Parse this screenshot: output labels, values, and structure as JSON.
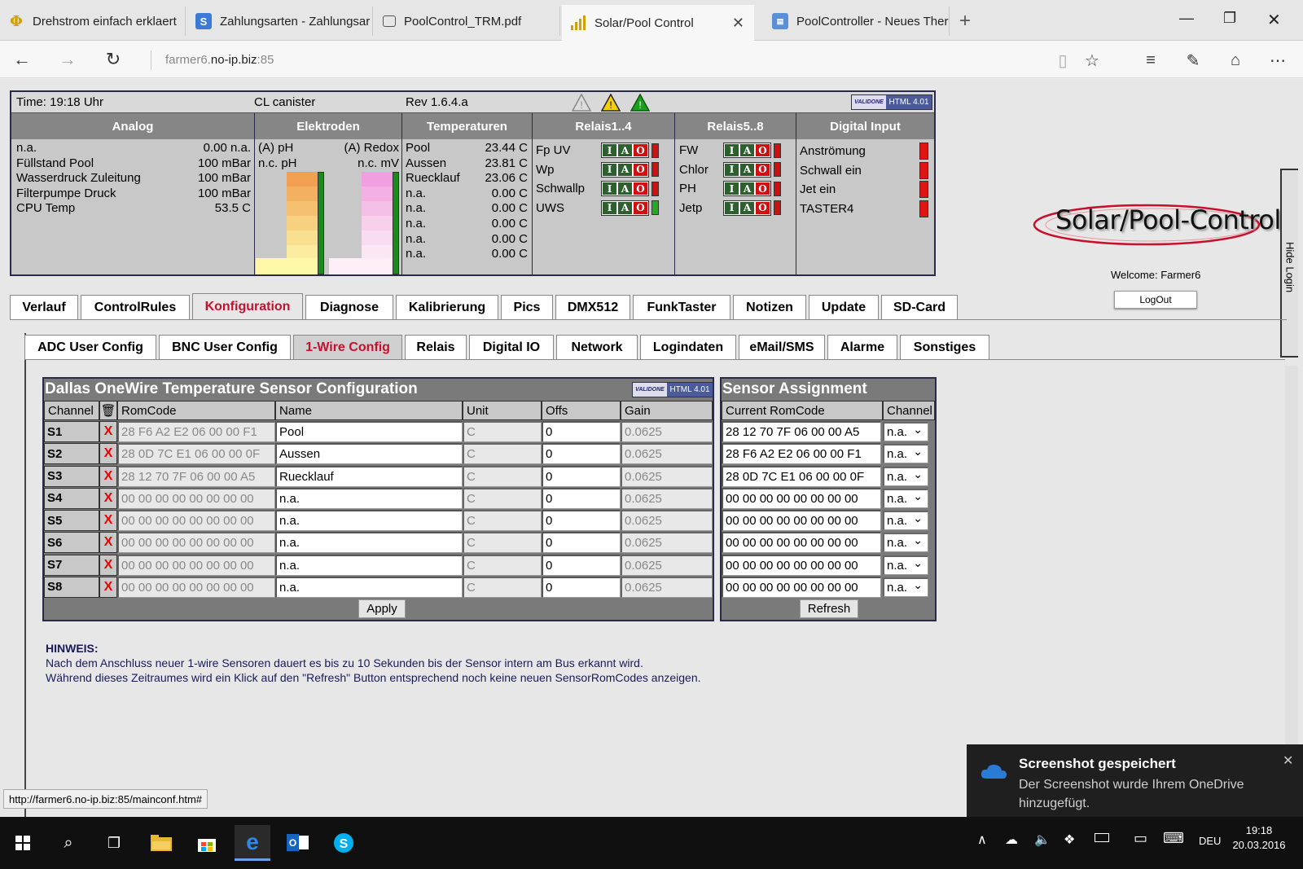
{
  "browser": {
    "tabs": [
      {
        "title": "Drehstrom einfach erklaert",
        "icon": "phi-icon",
        "active": false
      },
      {
        "title": "Zahlungsarten - Zahlungsar",
        "icon": "s-brand-icon",
        "active": false
      },
      {
        "title": "PoolControl_TRM.pdf",
        "icon": "pdf-doc-icon",
        "active": false
      },
      {
        "title": "Solar/Pool Control",
        "icon": "signal-bars-icon",
        "active": true
      },
      {
        "title": "PoolController - Neues Ther",
        "icon": "forum-icon",
        "active": false
      }
    ],
    "url_host_prefix": "farmer6.",
    "url_host": "no-ip.biz",
    "url_port": ":85"
  },
  "status": {
    "time": "Time: 19:18 Uhr",
    "cl": "CL canister",
    "rev": "Rev 1.6.4.a",
    "badge": "HTML 4.01",
    "badge_brand": "VALIDONE"
  },
  "panel": {
    "headers": {
      "analog": "Analog",
      "elektroden": "Elektroden",
      "temperaturen": "Temperaturen",
      "relais14": "Relais1..4",
      "relais58": "Relais5..8",
      "digital": "Digital Input"
    },
    "analog": [
      {
        "label": "n.a.",
        "value": "0.00 n.a."
      },
      {
        "label": "Füllstand Pool",
        "value": "100 mBar"
      },
      {
        "label": "Wasserdruck Zuleitung",
        "value": "100 mBar"
      },
      {
        "label": "Filterpumpe Druck",
        "value": "100 mBar"
      },
      {
        "label": "CPU Temp",
        "value": "53.5 C"
      }
    ],
    "elektroden": {
      "ph_label": "(A) pH",
      "ph_unit": "n.c. pH",
      "redox_label": "(A) Redox",
      "redox_unit": "n.c. mV"
    },
    "temps": [
      {
        "label": "Pool",
        "value": "23.44 C"
      },
      {
        "label": "Aussen",
        "value": "23.81 C"
      },
      {
        "label": "Ruecklauf",
        "value": "23.06 C"
      },
      {
        "label": "n.a.",
        "value": "0.00 C"
      },
      {
        "label": "n.a.",
        "value": "0.00 C"
      },
      {
        "label": "n.a.",
        "value": "0.00 C"
      },
      {
        "label": "n.a.",
        "value": "0.00 C"
      },
      {
        "label": "n.a.",
        "value": "0.00 C"
      }
    ],
    "relais14": [
      {
        "label": "Fp UV",
        "led": "#cc1111"
      },
      {
        "label": "Wp",
        "led": "#cc1111"
      },
      {
        "label": "Schwallp",
        "led": "#cc1111"
      },
      {
        "label": "UWS",
        "led": "#22aa22"
      }
    ],
    "relais58": [
      {
        "label": "FW",
        "led": "#cc1111"
      },
      {
        "label": "Chlor",
        "led": "#cc1111"
      },
      {
        "label": "PH",
        "led": "#cc1111"
      },
      {
        "label": "Jetp",
        "led": "#cc1111"
      }
    ],
    "relay_letters": [
      "I",
      "A",
      "O"
    ],
    "digital": [
      "Anströmung",
      "Schwall ein",
      "Jet ein",
      "TASTER4"
    ]
  },
  "side": {
    "logo": "Solar/Pool-Control",
    "welcome_label": "Welcome:",
    "user": "Farmer6",
    "logout": "LogOut",
    "hide_login": "Hide Login"
  },
  "main_tabs": [
    "Verlauf",
    "ControlRules",
    "Konfiguration",
    "Diagnose",
    "Kalibrierung",
    "Pics",
    "DMX512",
    "FunkTaster",
    "Notizen",
    "Update",
    "SD-Card"
  ],
  "main_tab_selected": "Konfiguration",
  "sub_tabs": [
    "ADC User Config",
    "BNC User Config",
    "1-Wire Config",
    "Relais",
    "Digital IO",
    "Network",
    "Logindaten",
    "eMail/SMS",
    "Alarme",
    "Sonstiges"
  ],
  "sub_tab_selected": "1-Wire Config",
  "onewire": {
    "title": "Dallas OneWire Temperature Sensor Configuration",
    "columns": {
      "channel": "Channel",
      "romcode": "RomCode",
      "name": "Name",
      "unit": "Unit",
      "offs": "Offs",
      "gain": "Gain"
    },
    "rows": [
      {
        "ch": "S1",
        "rom": "28 F6 A2 E2 06 00 00 F1",
        "name": "Pool",
        "unit": "C",
        "offs": "0",
        "gain": "0.0625"
      },
      {
        "ch": "S2",
        "rom": "28 0D 7C E1 06 00 00 0F",
        "name": "Aussen",
        "unit": "C",
        "offs": "0",
        "gain": "0.0625"
      },
      {
        "ch": "S3",
        "rom": "28 12 70 7F 06 00 00 A5",
        "name": "Ruecklauf",
        "unit": "C",
        "offs": "0",
        "gain": "0.0625"
      },
      {
        "ch": "S4",
        "rom": "00 00 00 00 00 00 00 00",
        "name": "n.a.",
        "unit": "C",
        "offs": "0",
        "gain": "0.0625"
      },
      {
        "ch": "S5",
        "rom": "00 00 00 00 00 00 00 00",
        "name": "n.a.",
        "unit": "C",
        "offs": "0",
        "gain": "0.0625"
      },
      {
        "ch": "S6",
        "rom": "00 00 00 00 00 00 00 00",
        "name": "n.a.",
        "unit": "C",
        "offs": "0",
        "gain": "0.0625"
      },
      {
        "ch": "S7",
        "rom": "00 00 00 00 00 00 00 00",
        "name": "n.a.",
        "unit": "C",
        "offs": "0",
        "gain": "0.0625"
      },
      {
        "ch": "S8",
        "rom": "00 00 00 00 00 00 00 00",
        "name": "n.a.",
        "unit": "C",
        "offs": "0",
        "gain": "0.0625"
      }
    ],
    "delete_mark": "X",
    "apply": "Apply"
  },
  "assign": {
    "title": "Sensor Assignment",
    "columns": {
      "current": "Current RomCode",
      "channel": "Channel"
    },
    "rows": [
      {
        "rom": "28 12 70 7F 06 00 00 A5",
        "channel": "n.a."
      },
      {
        "rom": "28 F6 A2 E2 06 00 00 F1",
        "channel": "n.a."
      },
      {
        "rom": "28 0D 7C E1 06 00 00 0F",
        "channel": "n.a."
      },
      {
        "rom": "00 00 00 00 00 00 00 00",
        "channel": "n.a."
      },
      {
        "rom": "00 00 00 00 00 00 00 00",
        "channel": "n.a."
      },
      {
        "rom": "00 00 00 00 00 00 00 00",
        "channel": "n.a."
      },
      {
        "rom": "00 00 00 00 00 00 00 00",
        "channel": "n.a."
      },
      {
        "rom": "00 00 00 00 00 00 00 00",
        "channel": "n.a."
      }
    ],
    "refresh": "Refresh"
  },
  "hint": {
    "title": "HINWEIS:",
    "line1": "Nach dem Anschluss neuer 1-wire Sensoren dauert es bis zu 10 Sekunden bis der Sensor intern am Bus erkannt wird.",
    "line2": "Während dieses Zeitraumes wird ein Klick auf den \"Refresh\" Button entsprechend noch keine neuen SensorRomCodes anzeigen."
  },
  "status_url": "http://farmer6.no-ip.biz:85/mainconf.htm#",
  "toast": {
    "title": "Screenshot gespeichert",
    "body": "Der Screenshot wurde Ihrem OneDrive hinzugefügt."
  },
  "taskbar": {
    "lang": "DEU",
    "time": "19:18",
    "date": "20.03.2016"
  },
  "colors": {
    "selected_tab_text": "#c8102e",
    "header_bg": "#868686",
    "table_bg": "#7a7a7a"
  }
}
